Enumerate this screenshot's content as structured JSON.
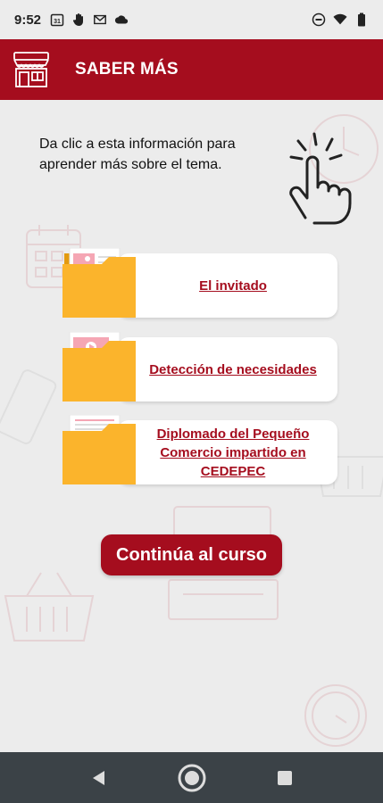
{
  "status_bar": {
    "time": "9:52",
    "calendar_day": "31",
    "left_icons": [
      "calendar-icon",
      "hand-icon",
      "gmail-icon",
      "cloud-icon"
    ],
    "right_icons": [
      "do-not-disturb-icon",
      "wifi-icon",
      "battery-icon"
    ]
  },
  "header": {
    "title": "SABER MÁS",
    "icon": "store-icon"
  },
  "main": {
    "intro": "Da clic a esta información para aprender más sobre el tema.",
    "items": [
      {
        "label": "El invitado",
        "folder_content": "image"
      },
      {
        "label": "Detección de necesidades",
        "folder_content": "video"
      },
      {
        "label": "Diplomado del Pequeño Comercio impartido en CEDEPEC",
        "folder_content": "document"
      }
    ],
    "cta_label": "Continúa al curso"
  },
  "nav": {
    "back": "back-icon",
    "home": "home-icon",
    "recents": "recents-icon"
  },
  "colors": {
    "brand": "#a50d1e",
    "background": "#ececec",
    "folder": "#fbb42c",
    "nav_bar": "#3b4247"
  }
}
